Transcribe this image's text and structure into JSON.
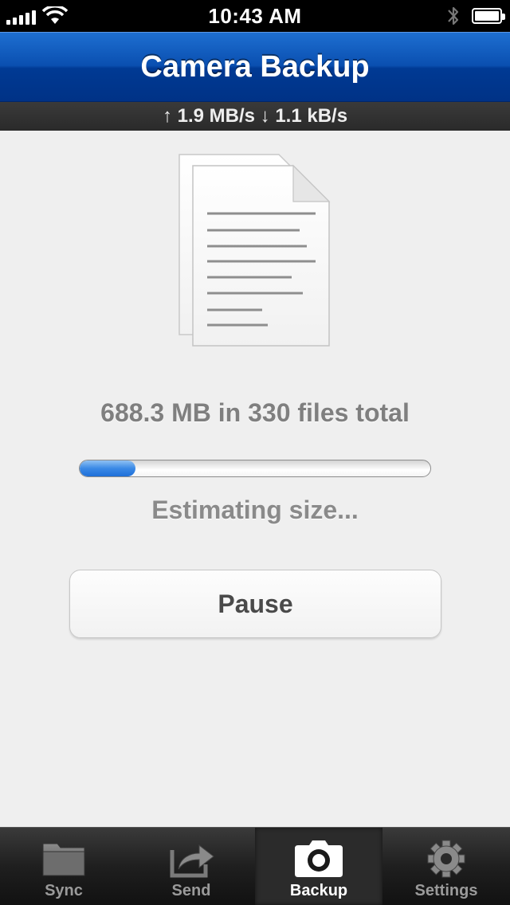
{
  "status_bar": {
    "time": "10:43 AM",
    "signal_icon": "signal-bars-icon",
    "wifi_icon": "wifi-icon",
    "bluetooth_icon": "bluetooth-icon",
    "battery_icon": "battery-icon"
  },
  "nav": {
    "title": "Camera Backup"
  },
  "speed": {
    "text": "↑ 1.9 MB/s ↓ 1.1 kB/s"
  },
  "main": {
    "illustration_icon": "documents-icon",
    "total_text": "688.3 MB in 330 files total",
    "progress": 0.16,
    "status_text": "Estimating size...",
    "pause_label": "Pause"
  },
  "tabs": [
    {
      "label": "Sync",
      "icon": "folder-icon",
      "active": false
    },
    {
      "label": "Send",
      "icon": "share-icon",
      "active": false
    },
    {
      "label": "Backup",
      "icon": "camera-icon",
      "active": true
    },
    {
      "label": "Settings",
      "icon": "gear-icon",
      "active": false
    }
  ],
  "colors": {
    "nav_blue": "#0a4fb0",
    "progress_blue": "#3a89e6"
  }
}
